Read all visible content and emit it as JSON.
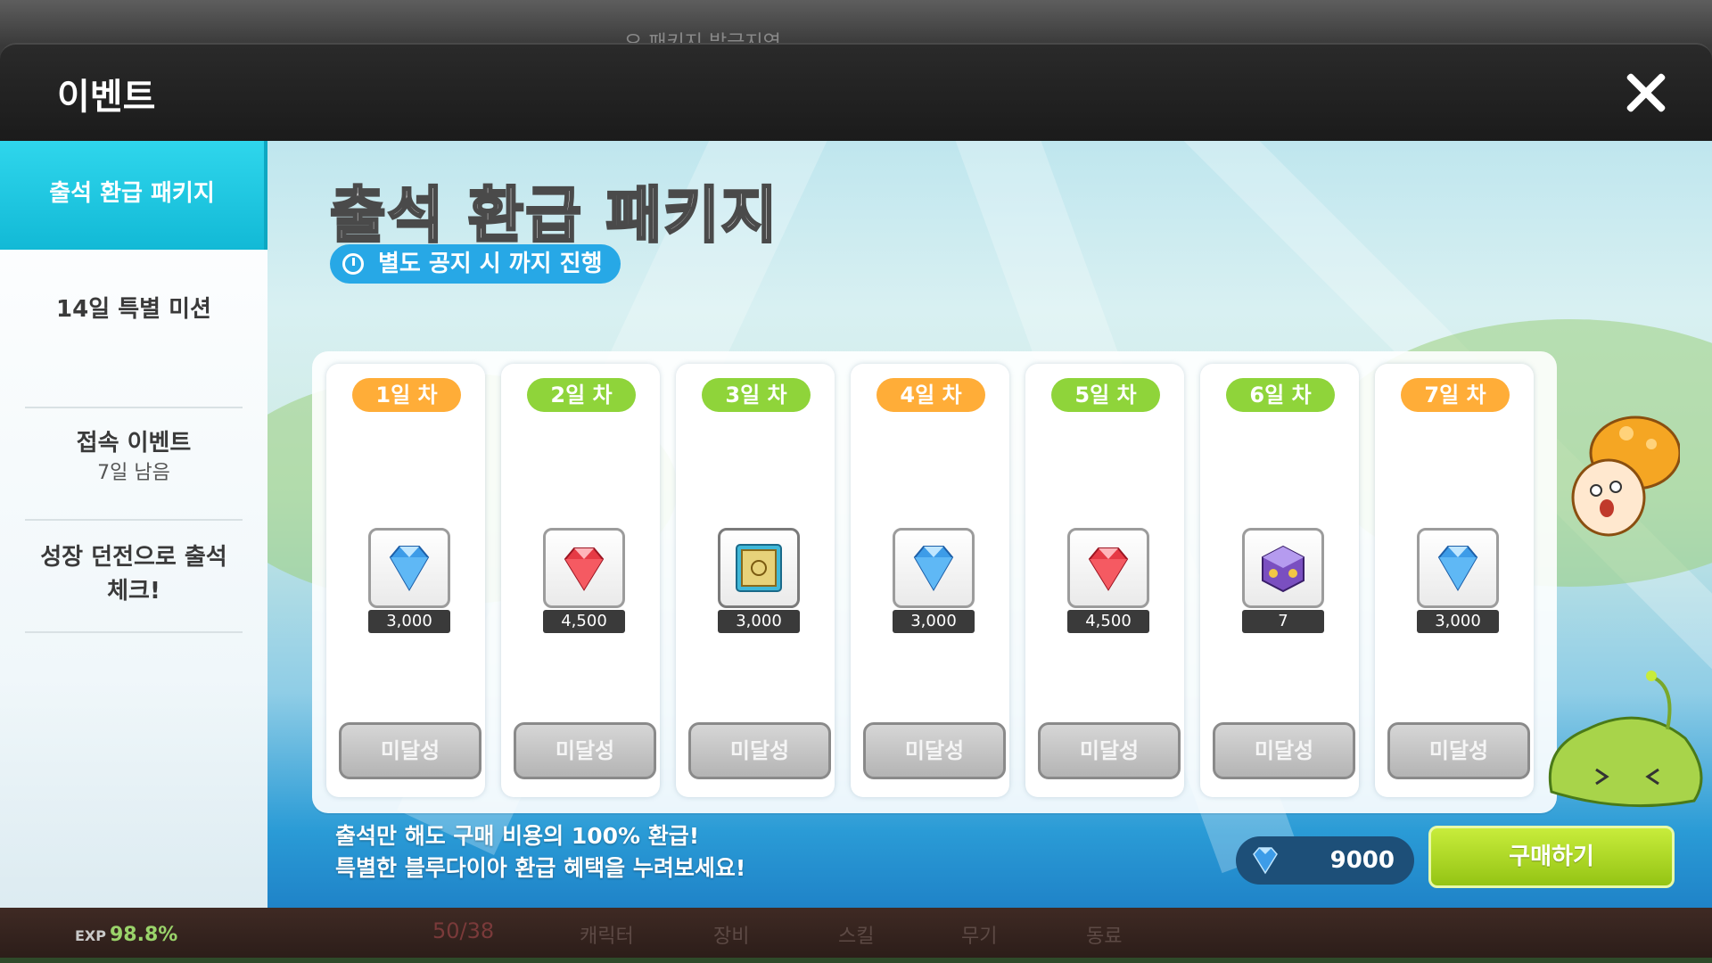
{
  "colors": {
    "accent_cyan": "#12b9d6",
    "badge_orange": "#ffad38",
    "badge_green": "#8fd43a",
    "buy_green": "#94c414",
    "period_blue": "#27a8e6"
  },
  "background": {
    "top_text": "오 패키지 발급지역",
    "exp_label": "EXP",
    "exp_value": "98.8%",
    "stat_value": "50/38",
    "menu": [
      "캐릭터",
      "장비",
      "스킬",
      "무기",
      "동료"
    ]
  },
  "modal": {
    "title": "이벤트",
    "close_icon": "close-icon"
  },
  "sidebar": {
    "items": [
      {
        "label": "출석 환급 패키지",
        "active": true
      },
      {
        "label": "14일 특별 미션"
      },
      {
        "label": "접속 이벤트",
        "sub": "7일 남음"
      },
      {
        "label": "성장 던전으로 출석",
        "label2": "체크!"
      }
    ]
  },
  "banner": {
    "title": "출석 환급 패키지",
    "period": "별도 공지 시 까지 진행"
  },
  "days": [
    {
      "label": "1일 차",
      "badge_color": "orange",
      "item_icon": "blue-diamond-icon",
      "count": "3,000",
      "status": "미달성"
    },
    {
      "label": "2일 차",
      "badge_color": "green",
      "item_icon": "red-ruby-icon",
      "count": "4,500",
      "status": "미달성"
    },
    {
      "label": "3일 차",
      "badge_color": "green",
      "item_icon": "scroll-icon",
      "count": "3,000",
      "status": "미달성"
    },
    {
      "label": "4일 차",
      "badge_color": "orange",
      "item_icon": "blue-diamond-icon",
      "count": "3,000",
      "status": "미달성"
    },
    {
      "label": "5일 차",
      "badge_color": "green",
      "item_icon": "red-ruby-icon",
      "count": "4,500",
      "status": "미달성"
    },
    {
      "label": "6일 차",
      "badge_color": "green",
      "item_icon": "cube-icon",
      "count": "7",
      "status": "미달성"
    },
    {
      "label": "7일 차",
      "badge_color": "orange",
      "item_icon": "blue-diamond-icon",
      "count": "3,000",
      "status": "미달성"
    }
  ],
  "footer": {
    "line1": "출석만 해도 구매 비용의 100% 환급!",
    "line2": "특별한 블루다이아 환급 혜택을 누려보세요!",
    "price": "9000",
    "buy_label": "구매하기"
  }
}
